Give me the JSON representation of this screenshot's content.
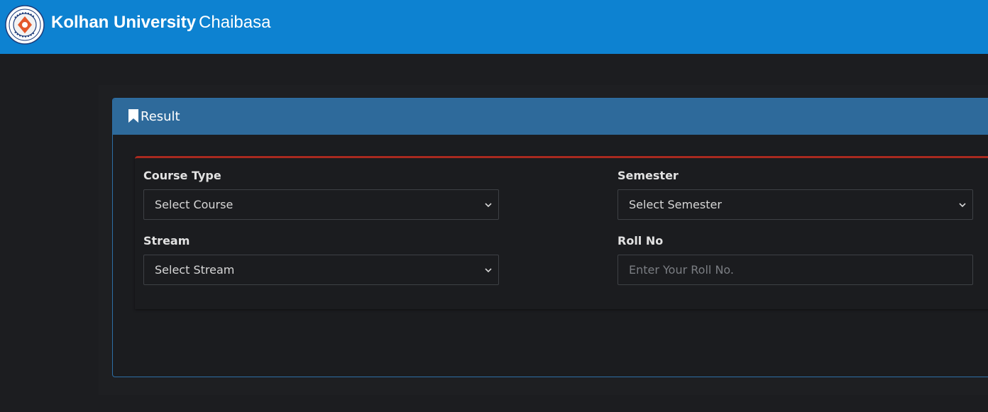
{
  "header": {
    "brand_bold": "Kolhan University",
    "brand_city": "Chaibasa",
    "logo_icon": "university-seal-icon",
    "background_color": "#0d82d1"
  },
  "card": {
    "title": "Result",
    "title_icon": "bookmark-icon",
    "header_color": "#2e6a9b",
    "accent_color": "#a82a1f"
  },
  "form": {
    "course_type": {
      "label": "Course Type",
      "selected": "Select Course"
    },
    "semester": {
      "label": "Semester",
      "selected": "Select Semester"
    },
    "stream": {
      "label": "Stream",
      "selected": "Select Stream"
    },
    "roll_no": {
      "label": "Roll No",
      "placeholder": "Enter Your Roll No.",
      "value": ""
    }
  }
}
